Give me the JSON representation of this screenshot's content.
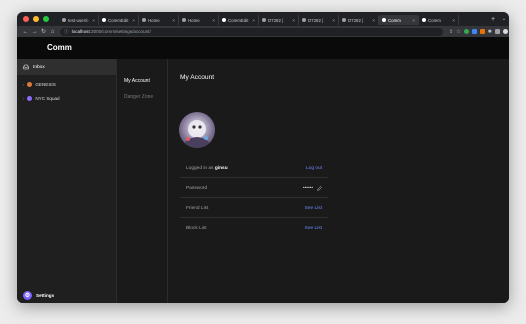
{
  "browser": {
    "tabs": [
      {
        "title": "test-user/c",
        "icon_color": "#9aa0a6"
      },
      {
        "title": "CommEdit",
        "icon_color": "#ffffff"
      },
      {
        "title": "Home",
        "icon_color": "#9aa0a6"
      },
      {
        "title": "Home",
        "icon_color": "#9aa0a6"
      },
      {
        "title": "CommEdit",
        "icon_color": "#ffffff"
      },
      {
        "title": "D7282 |",
        "icon_color": "#9aa0a6"
      },
      {
        "title": "D7282 |",
        "icon_color": "#9aa0a6"
      },
      {
        "title": "D7282 |",
        "icon_color": "#9aa0a6"
      },
      {
        "title": "Comm",
        "icon_color": "#ffffff",
        "active": true
      },
      {
        "title": "Comm",
        "icon_color": "#ffffff"
      }
    ],
    "new_tab": "+",
    "tab_menu": "⌄",
    "url_host": "localhost",
    "url_rest": ":3000/comm/settings/account/"
  },
  "app": {
    "title": "Comm",
    "inbox_label": "Inbox",
    "communities": [
      {
        "name": "GENESIS",
        "color": "#e07a3a"
      },
      {
        "name": "NYC Squad",
        "color": "#8b6cff"
      }
    ],
    "settings_label": "Settings"
  },
  "subnav": {
    "items": [
      "My Account",
      "Danger Zone"
    ]
  },
  "account": {
    "title": "My Account",
    "logged_in_prefix": "Logged in as",
    "username": "ginsu",
    "log_out": "Log out",
    "password_label": "Password",
    "password_mask": "••••••",
    "friend_list_label": "Friend List",
    "friend_list_action": "See List",
    "block_list_label": "Block List",
    "block_list_action": "See List"
  },
  "colors": {
    "accent": "#6b8cff",
    "settings_icon": "#7b61ff",
    "traffic_red": "#ff5f57",
    "traffic_yellow": "#febc2e",
    "traffic_green": "#28c840"
  }
}
